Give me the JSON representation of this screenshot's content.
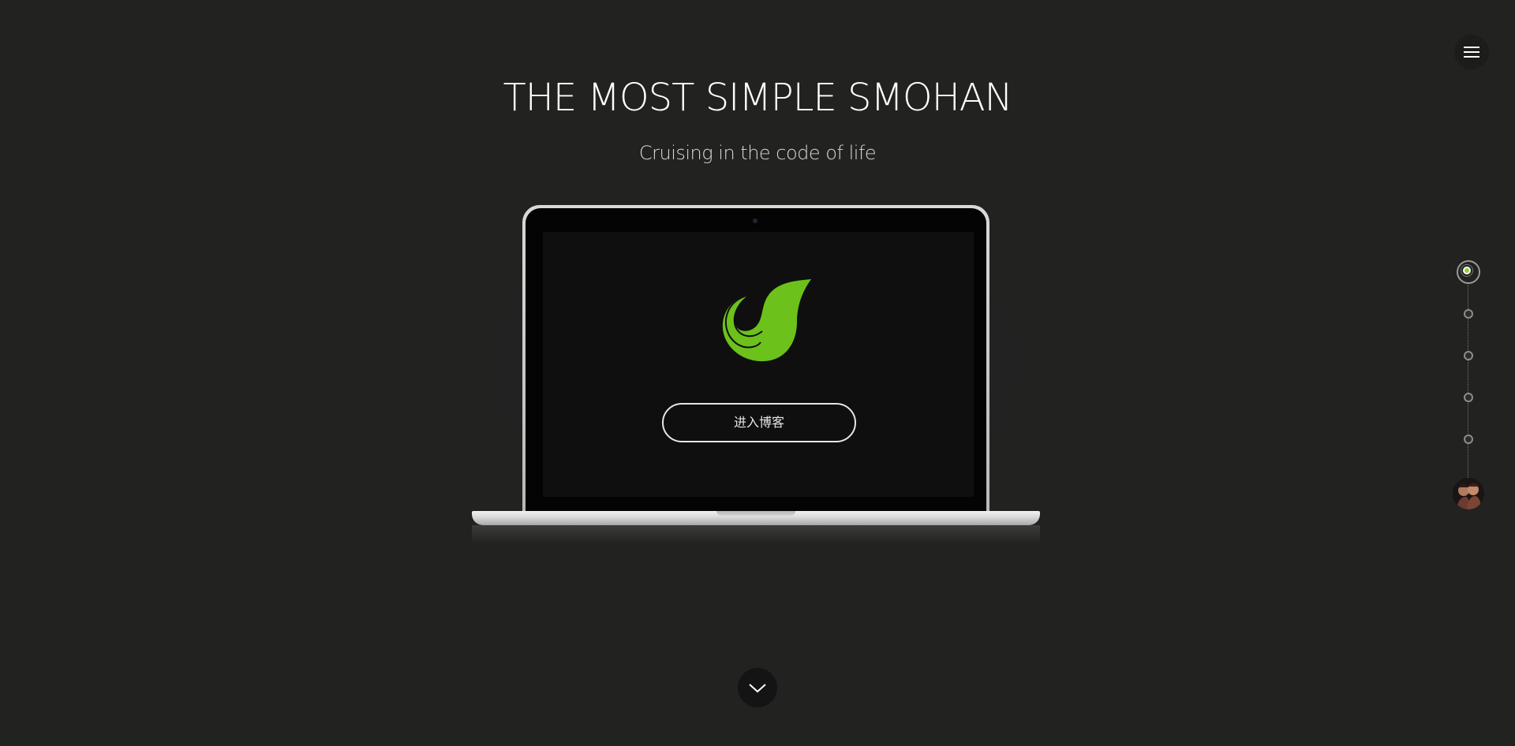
{
  "header": {
    "title": "THE MOST SIMPLE SMOHAN",
    "subtitle": "Cruising in the code of life",
    "menu_icon": "hamburger-menu-icon"
  },
  "hero": {
    "logo_icon": "leaf-logo-icon",
    "enter_button_label": "进入博客",
    "accent_color": "#6cc11a"
  },
  "scroll": {
    "icon": "chevron-down-icon"
  },
  "side_nav": {
    "dots": [
      {
        "state": "active"
      },
      {
        "state": "inactive"
      },
      {
        "state": "inactive"
      },
      {
        "state": "inactive"
      },
      {
        "state": "inactive"
      }
    ],
    "avatar": "avatar-icon",
    "active_color": "#8bd62c"
  }
}
